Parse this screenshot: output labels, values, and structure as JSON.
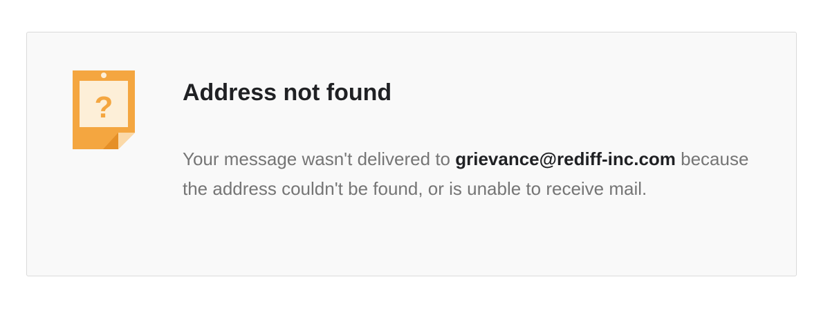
{
  "notice": {
    "icon": "question-note-icon",
    "title": "Address not found",
    "message_before": "Your message wasn't delivered to ",
    "recipient": "grievance@rediff-inc.com",
    "message_after": " because the address couldn't be found, or is unable to receive mail."
  },
  "colors": {
    "icon_orange": "#f4a640",
    "icon_fill": "#fdefd8",
    "card_background": "#f9f9f9",
    "card_border": "#dadada",
    "title_text": "#202124",
    "body_text": "#757575"
  }
}
